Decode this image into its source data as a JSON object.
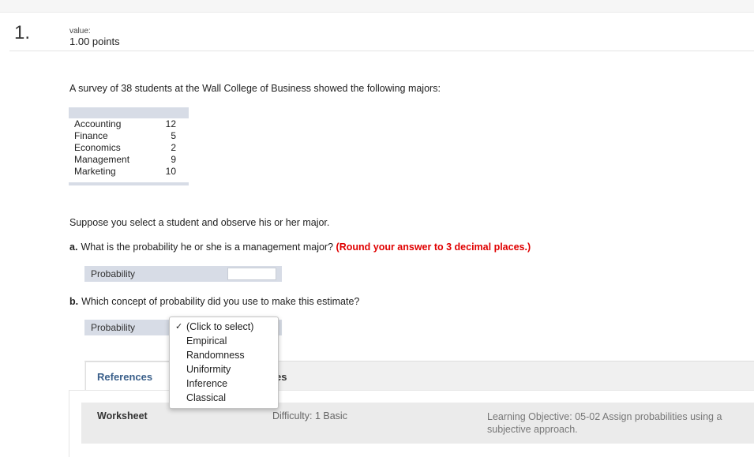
{
  "question": {
    "number": "1.",
    "value_label": "value:",
    "value_points": "1.00 points",
    "intro": "A survey of 38 students at the Wall College of Business showed the following majors:",
    "majors": [
      {
        "name": "Accounting",
        "count": "12"
      },
      {
        "name": "Finance",
        "count": "5"
      },
      {
        "name": "Economics",
        "count": "2"
      },
      {
        "name": "Management",
        "count": "9"
      },
      {
        "name": "Marketing",
        "count": "10"
      }
    ],
    "suppose": "Suppose you select a student and observe his or her major.",
    "part_a": {
      "label": "a.",
      "text": "What is the probability he or she is a management major?",
      "hint": "(Round your answer to 3 decimal places.)",
      "answer_label": "Probability",
      "answer_value": ""
    },
    "part_b": {
      "label": "b.",
      "text": "Which concept of probability did you use to make this estimate?",
      "answer_label": "Probability",
      "check_mark": "✓",
      "options": [
        "(Click to select)",
        "Empirical",
        "Randomness",
        "Uniformity",
        "Inference",
        "Classical"
      ],
      "selected": "(Click to select)"
    }
  },
  "tabs": {
    "references": "References",
    "partial_tab_text": "es"
  },
  "reference_panel": {
    "worksheet": "Worksheet",
    "difficulty": "Difficulty: 1 Basic",
    "objective_line1": "Learning Objective: 05-02 Assign probabilities using a",
    "objective_line2": "subjective approach."
  },
  "colors": {
    "hint_red": "#e00000",
    "table_band": "#d7dce6",
    "tab_link": "#3a5f8a"
  }
}
